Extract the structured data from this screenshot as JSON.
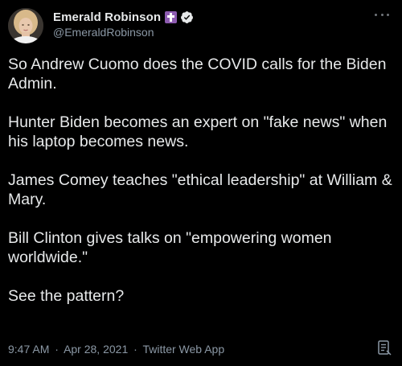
{
  "header": {
    "display_name": "Emerald Robinson",
    "handle": "@EmeraldRobinson",
    "badges": [
      "cross-icon",
      "verified-badge-icon"
    ],
    "more_icon": "more-options-icon"
  },
  "tweet": {
    "paragraphs": [
      "So Andrew Cuomo does the COVID calls for the Biden Admin.",
      "Hunter Biden becomes an expert on \"fake news\" when his laptop becomes news.",
      "James Comey teaches \"ethical leadership\" at William & Mary.",
      "Bill Clinton gives talks on \"empowering women worldwide.\"",
      "See the pattern?"
    ]
  },
  "footer": {
    "time": "9:47 AM",
    "date": "Apr 28, 2021",
    "separator": "·",
    "source": "Twitter Web App",
    "analytics_icon": "document-icon"
  },
  "colors": {
    "background": "#000000",
    "text": "#e7e9ea",
    "secondary": "#8b98a5",
    "cross_badge": "#8d5bb0"
  }
}
